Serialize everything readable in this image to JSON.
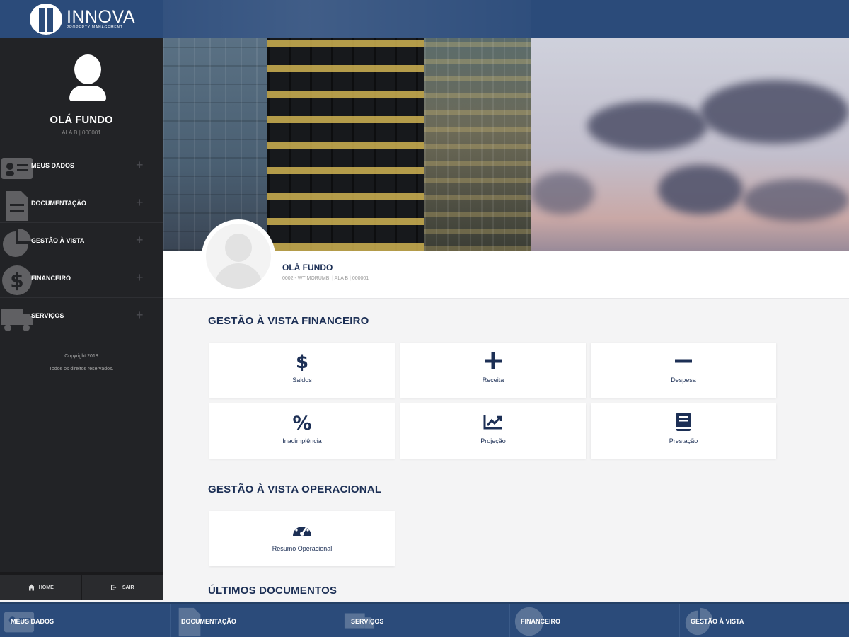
{
  "brand": {
    "name": "INNOVA",
    "tagline": "PROPERTY MANAGEMENT"
  },
  "sidebar": {
    "user_name": "OLÁ FUNDO",
    "user_sub": "ALA B | 000001",
    "items": [
      {
        "label": "MEUS DADOS",
        "icon": "id-card-icon"
      },
      {
        "label": "DOCUMENTAÇÃO",
        "icon": "document-icon"
      },
      {
        "label": "GESTÃO À VISTA",
        "icon": "pie-chart-icon"
      },
      {
        "label": "FINANCEIRO",
        "icon": "dollar-icon"
      },
      {
        "label": "SERVIÇOS",
        "icon": "truck-icon"
      }
    ],
    "expand_symbol": "+",
    "copyright_line1": "Copyright 2018",
    "copyright_line2": "Todos os direitos reservados.",
    "footer": {
      "home_label": "HOME",
      "logout_label": "SAIR"
    }
  },
  "profile": {
    "name": "OLÁ FUNDO",
    "sub": "0002 - WT MORUMBI | ALA B | 000001"
  },
  "sections": {
    "financeiro": {
      "title": "GESTÃO À VISTA FINANCEIRO",
      "cards": [
        {
          "label": "Saldos",
          "icon": "dollar-icon"
        },
        {
          "label": "Receita",
          "icon": "plus-icon"
        },
        {
          "label": "Despesa",
          "icon": "minus-icon"
        },
        {
          "label": "Inadimplência",
          "icon": "percent-icon"
        },
        {
          "label": "Projeção",
          "icon": "trending-chart-icon"
        },
        {
          "label": "Prestação",
          "icon": "book-icon"
        }
      ]
    },
    "operacional": {
      "title": "GESTÃO À VISTA OPERACIONAL",
      "cards": [
        {
          "label": "Resumo Operacional",
          "icon": "speedometer-icon"
        }
      ]
    },
    "documentos": {
      "title": "ÚLTIMOS DOCUMENTOS"
    }
  },
  "bottom_nav": [
    {
      "label": "MEUS DADOS"
    },
    {
      "label": "DOCUMENTAÇÃO"
    },
    {
      "label": "SERVIÇOS"
    },
    {
      "label": "FINANCEIRO"
    },
    {
      "label": "GESTÃO À VISTA"
    }
  ],
  "colors": {
    "brand_blue": "#2b4b7a",
    "sidebar_bg": "#222326",
    "navy_text": "#1c2f55",
    "page_bg": "#f4f4f5"
  }
}
